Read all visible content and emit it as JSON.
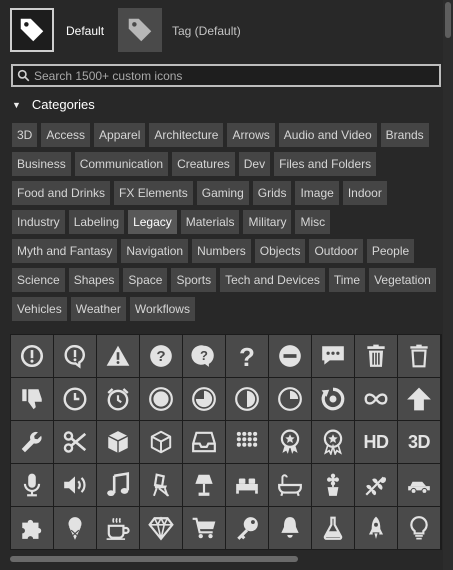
{
  "tags": [
    {
      "label": "Default",
      "icon": "tag-icon",
      "selected": true
    },
    {
      "label": "Tag (Default)",
      "icon": "tag-icon",
      "selected": false
    }
  ],
  "search": {
    "placeholder": "Search 1500+ custom icons",
    "value": ""
  },
  "categories": {
    "heading": "Categories",
    "items": [
      "3D",
      "Access",
      "Apparel",
      "Architecture",
      "Arrows",
      "Audio and Video",
      "Brands",
      "Business",
      "Communication",
      "Creatures",
      "Dev",
      "Files and Folders",
      "Food and Drinks",
      "FX Elements",
      "Gaming",
      "Grids",
      "Image",
      "Indoor",
      "Industry",
      "Labeling",
      "Legacy",
      "Materials",
      "Military",
      "Misc",
      "Myth and Fantasy",
      "Navigation",
      "Numbers",
      "Objects",
      "Outdoor",
      "People",
      "Science",
      "Shapes",
      "Space",
      "Sports",
      "Tech and Devices",
      "Time",
      "Vegetation",
      "Vehicles",
      "Weather",
      "Workflows"
    ],
    "active": "Legacy"
  },
  "icons": [
    "exclamation-circle-icon",
    "exclamation-bubble-icon",
    "warning-triangle-icon",
    "question-circle-icon",
    "question-bubble-icon",
    "question-mark-icon",
    "minus-circle-icon",
    "chat-bubble-icon",
    "trash-filled-icon",
    "trash-outline-icon",
    "thumbs-down-icon",
    "clock-icon",
    "alarm-clock-icon",
    "record-icon",
    "pie-quarter-icon",
    "half-circle-icon",
    "pie-three-quarter-icon",
    "refresh-circle-icon",
    "infinity-icon",
    "arrow-up-icon",
    "wrench-icon",
    "scissors-icon",
    "cube-filled-icon",
    "cube-outline-icon",
    "inbox-icon",
    "dots-grid-icon",
    "award-ribbon-icon",
    "award-ribbon-alt-icon",
    "hd-icon",
    "3d-icon",
    "microphone-icon",
    "speaker-icon",
    "music-note-icon",
    "chair-icon",
    "lamp-icon",
    "bed-icon",
    "bathtub-icon",
    "flower-pot-icon",
    "leaf-branch-icon",
    "car-icon",
    "puzzle-icon",
    "ice-cream-icon",
    "coffee-cup-icon",
    "diamond-icon",
    "shopping-cart-icon",
    "key-icon",
    "bell-icon",
    "flask-icon",
    "rocket-icon",
    "lightbulb-icon"
  ],
  "icon_text": {
    "hd-icon": "HD",
    "3d-icon": "3D"
  }
}
